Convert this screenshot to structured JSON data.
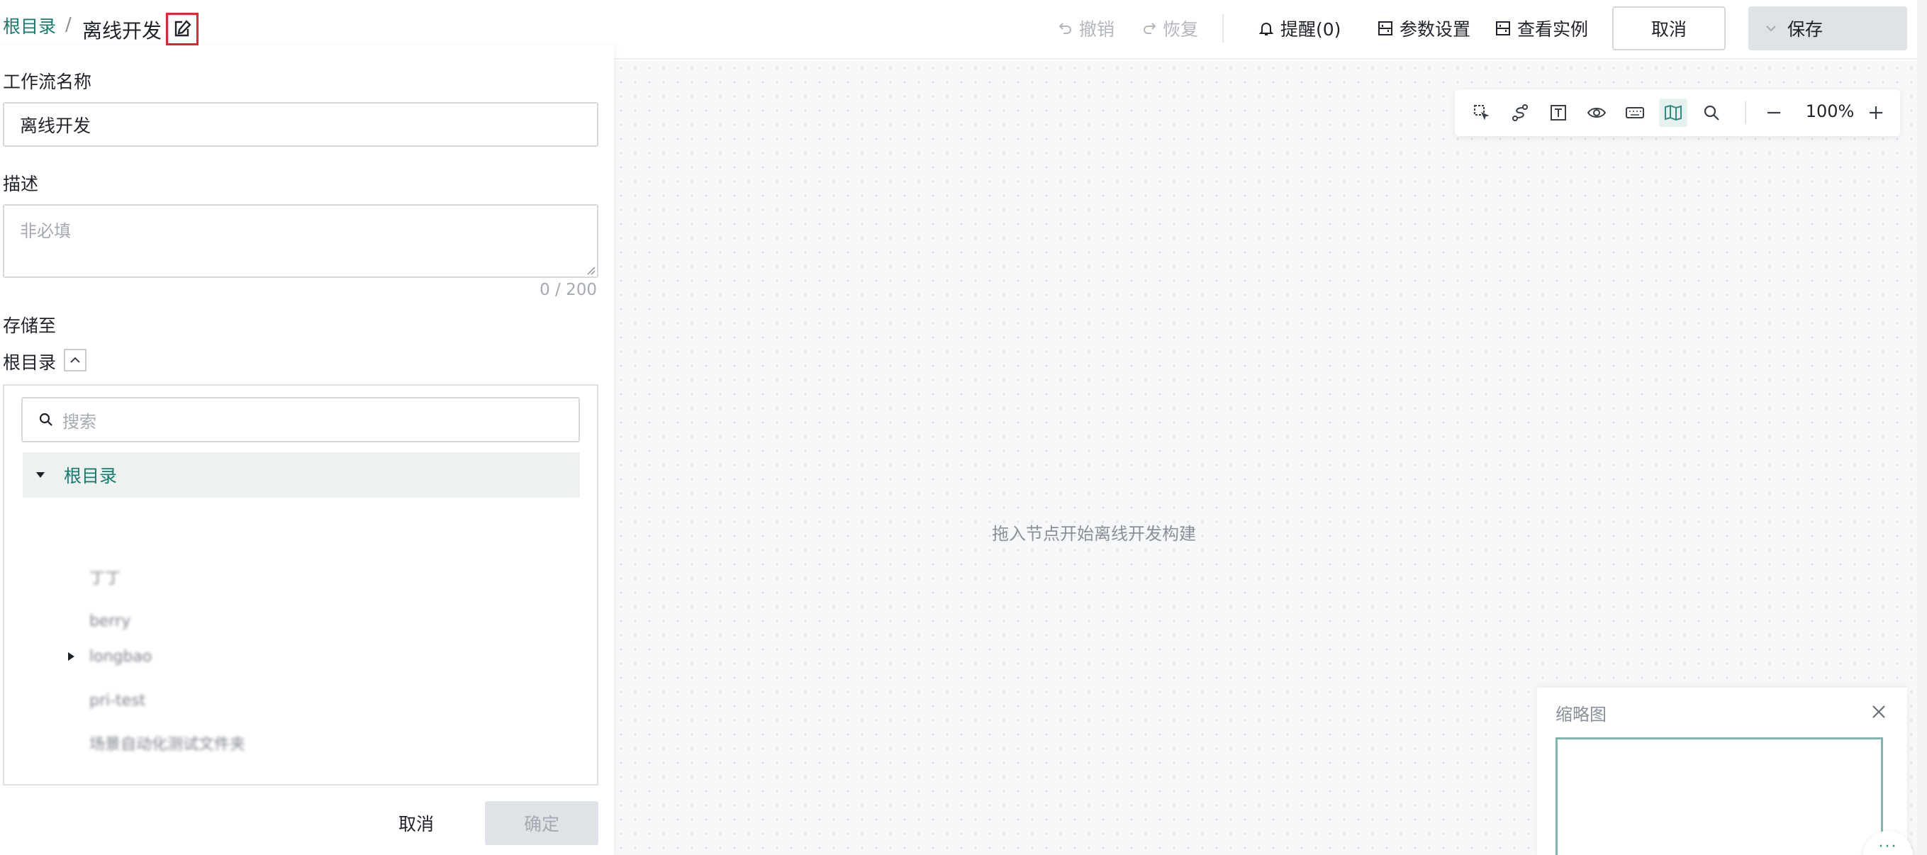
{
  "breadcrumb": {
    "root": "根目录",
    "separator": "/",
    "current": "离线开发"
  },
  "header": {
    "undo": "撤销",
    "redo": "恢复",
    "reminder": "提醒(0)",
    "params": "参数设置",
    "instances": "查看实例",
    "cancel": "取消",
    "save": "保存"
  },
  "form": {
    "name_label": "工作流名称",
    "name_value": "离线开发",
    "desc_label": "描述",
    "desc_placeholder": "非必填",
    "desc_counter": "0 / 200",
    "storage_label": "存储至",
    "storage_value": "根目录",
    "search_placeholder": "搜索",
    "tree_root": "根目录",
    "tree_children": [
      {
        "label": "丁丁",
        "expandable": false
      },
      {
        "label": "berry",
        "expandable": false
      },
      {
        "label": "longbao",
        "expandable": true
      },
      {
        "label": "pri-test",
        "expandable": false
      },
      {
        "label": "场景自动化测试文件夹",
        "expandable": false
      }
    ],
    "cancel": "取消",
    "confirm": "确定"
  },
  "canvas": {
    "hint": "拖入节点开始离线开发构建",
    "zoom": "100%",
    "minimap_title": "缩略图",
    "more": "···"
  },
  "colors": {
    "accent": "#177b6e",
    "highlight": "#e8242e",
    "disabled_bg": "#dfe2e6"
  },
  "icons": {
    "toolbar": [
      "select-area-icon",
      "connect-icon",
      "text-icon",
      "eye-icon",
      "keyboard-icon",
      "map-icon",
      "search-icon",
      "zoom-out-icon",
      "zoom-in-icon"
    ]
  }
}
